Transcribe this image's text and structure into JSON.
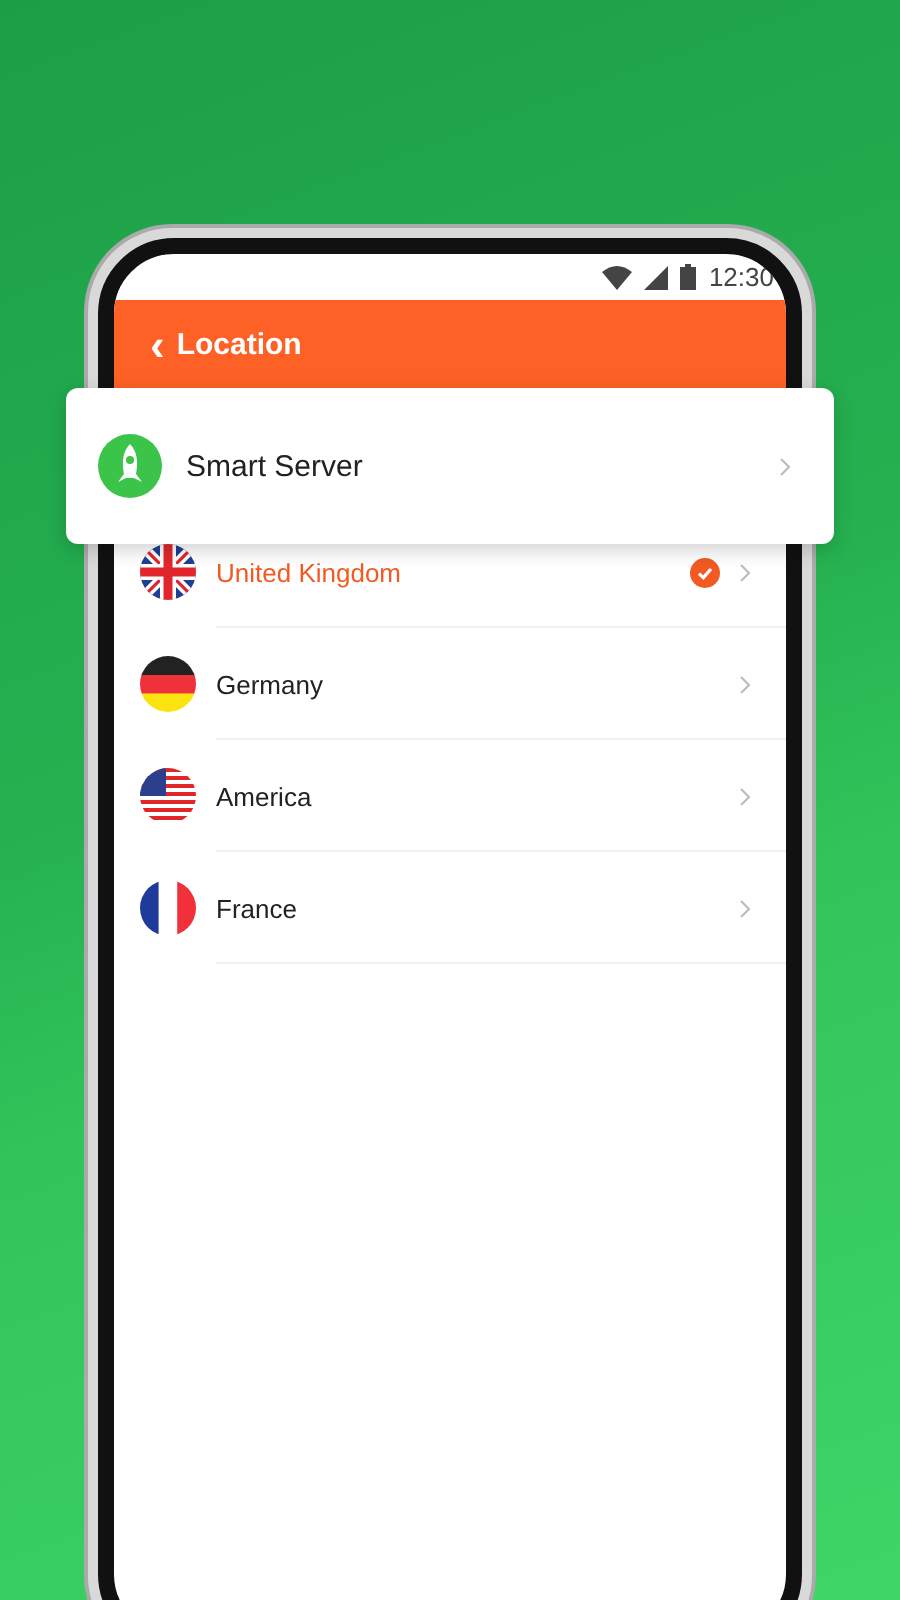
{
  "status_bar": {
    "time": "12:30"
  },
  "header": {
    "back_icon": "‹",
    "title": "Location"
  },
  "smart_server": {
    "label": "Smart Server"
  },
  "locations": [
    {
      "name": "United Kingdom",
      "kind": "uk",
      "selected": true
    },
    {
      "name": "Germany",
      "kind": "de",
      "selected": false
    },
    {
      "name": "America",
      "kind": "us",
      "selected": false
    },
    {
      "name": "France",
      "kind": "fr",
      "selected": false
    }
  ]
}
